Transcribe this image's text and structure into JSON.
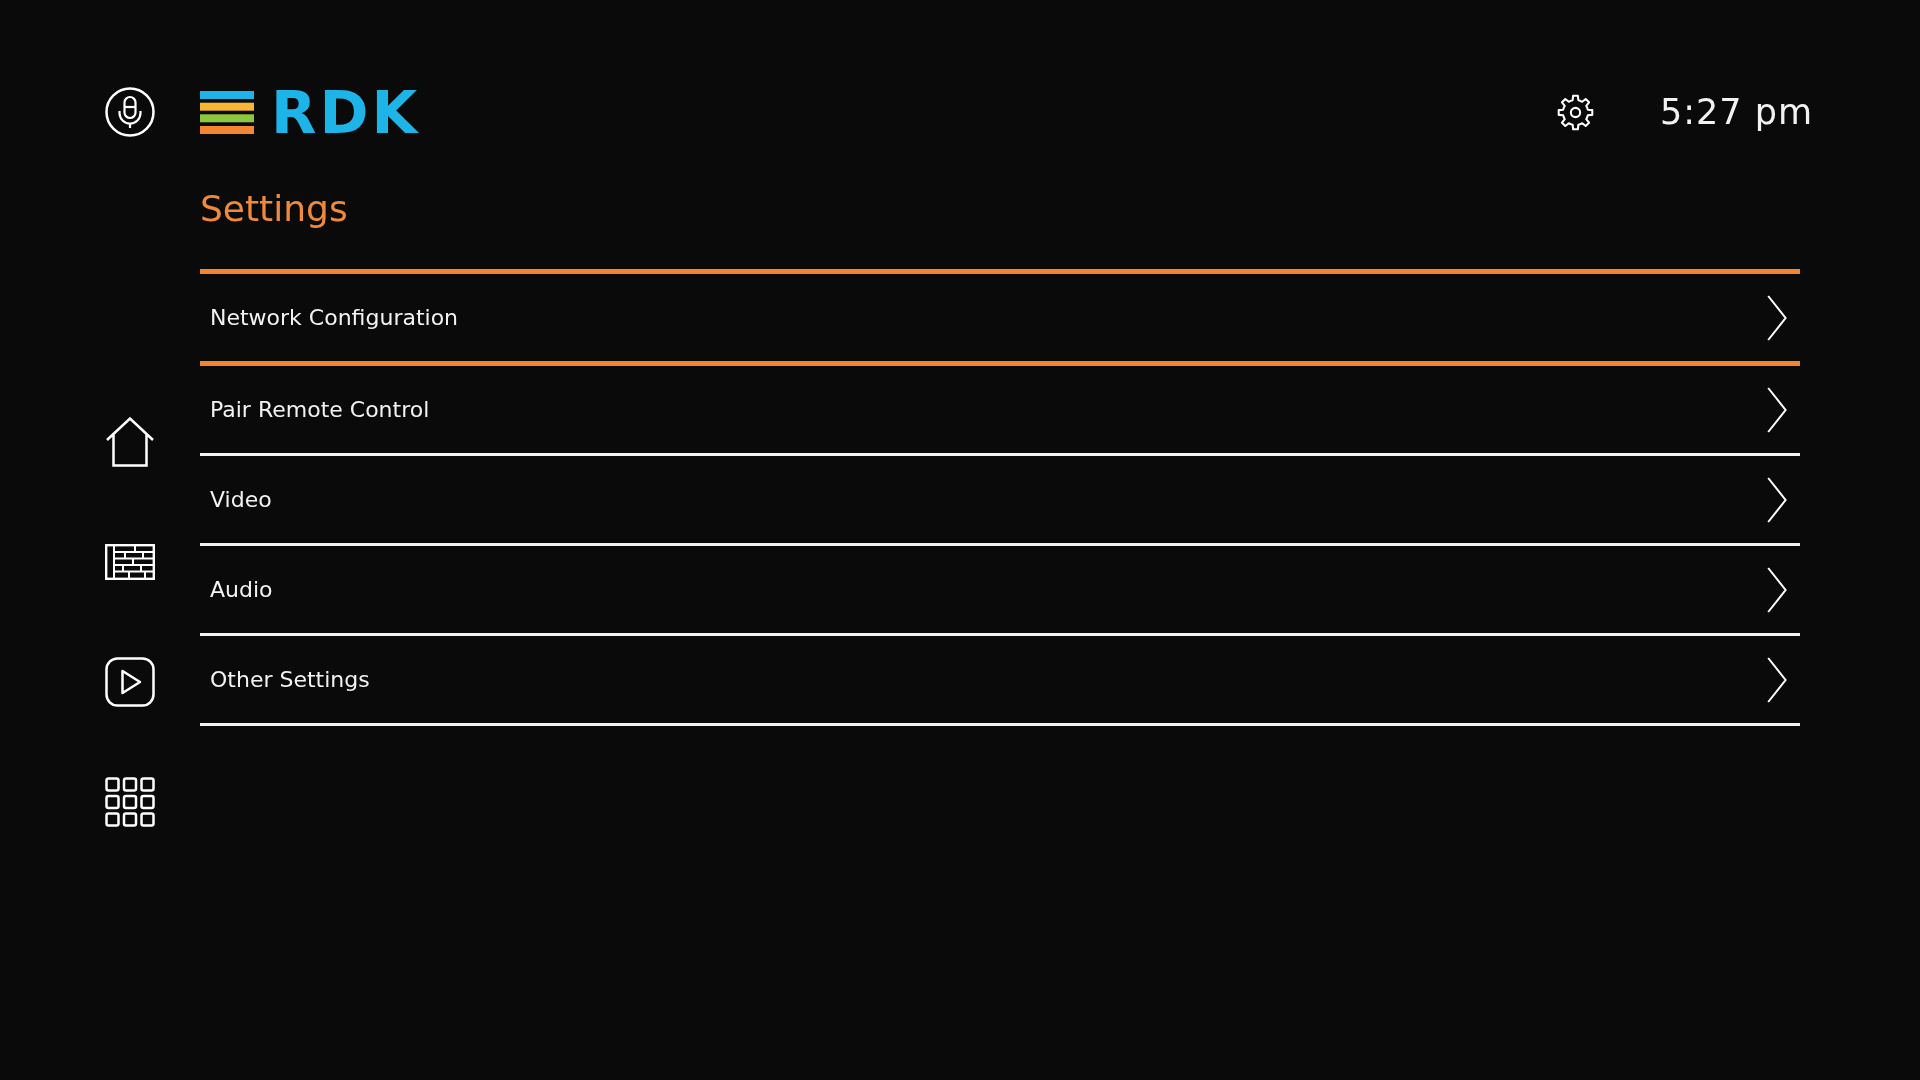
{
  "header": {
    "logo": "RDK",
    "time": "5:27 pm"
  },
  "page": {
    "title": "Settings"
  },
  "menu": {
    "items": [
      {
        "label": "Network Configuration",
        "selected": true
      },
      {
        "label": "Pair Remote Control",
        "selected": false
      },
      {
        "label": "Video",
        "selected": false
      },
      {
        "label": "Audio",
        "selected": false
      },
      {
        "label": "Other Settings",
        "selected": false
      }
    ]
  }
}
